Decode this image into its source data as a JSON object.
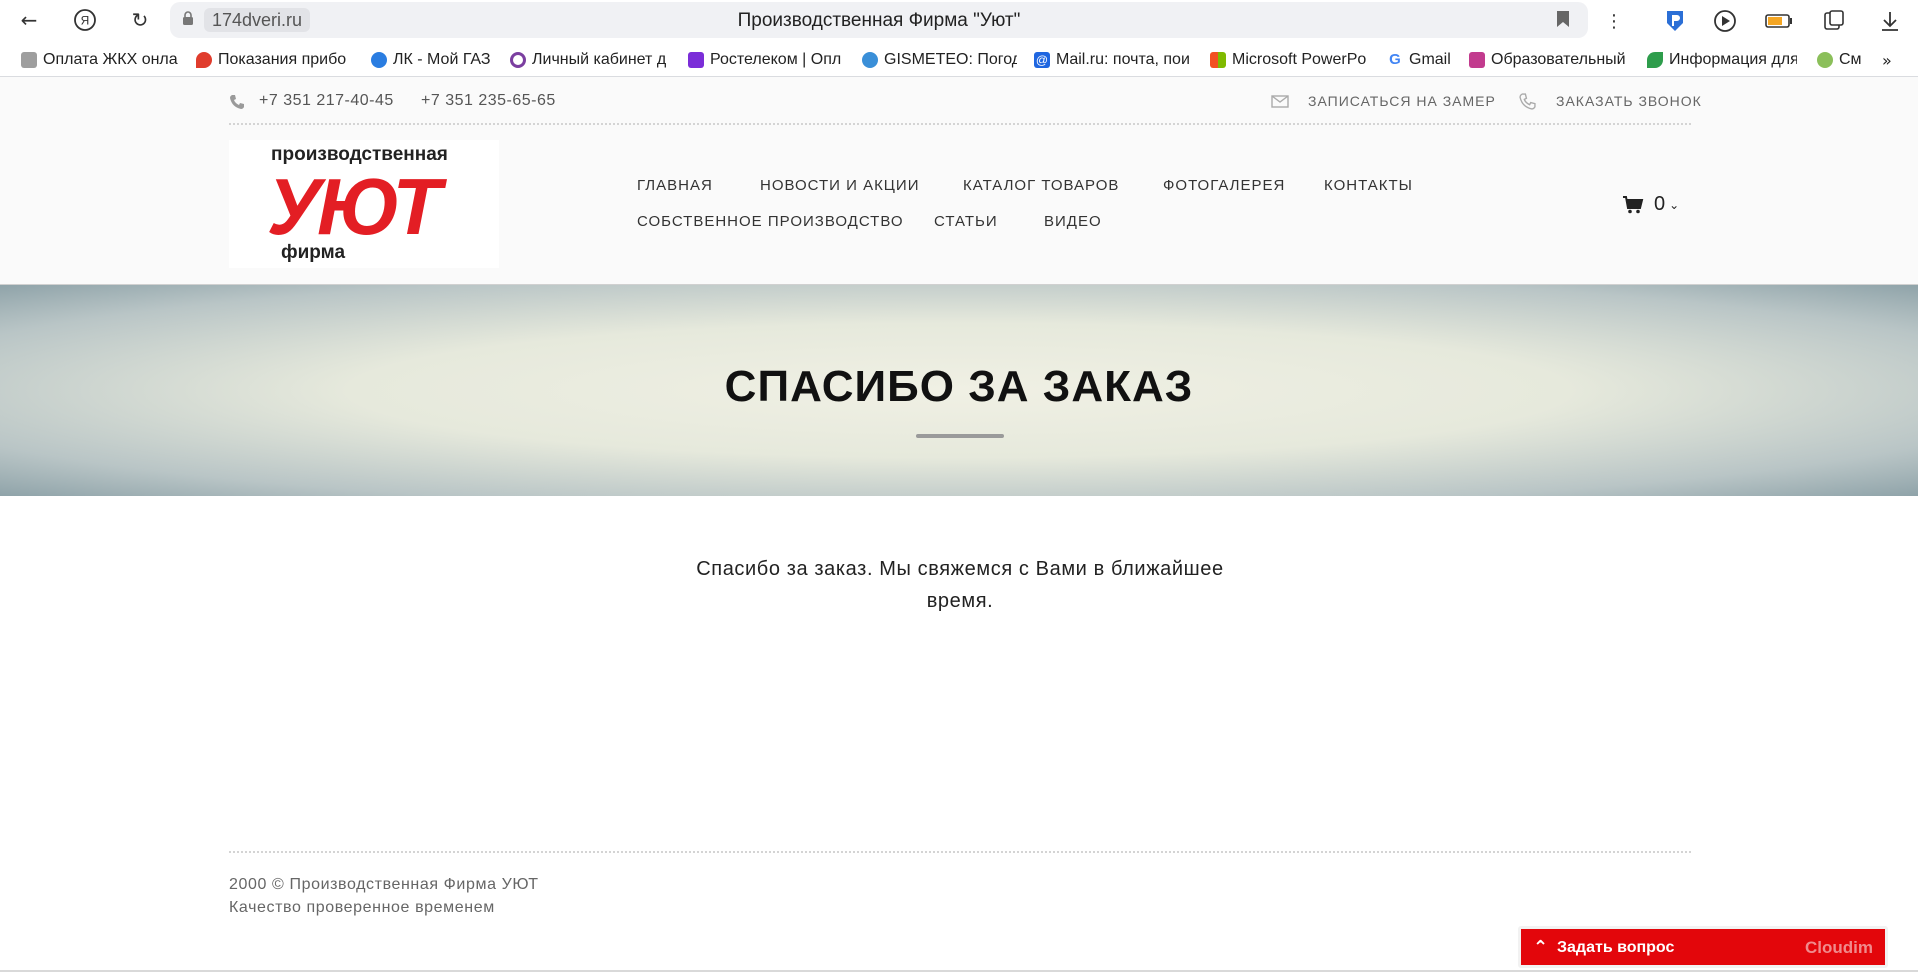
{
  "browser": {
    "url": "174dveri.ru",
    "tab_title": "Производственная Фирма \"Уют\"",
    "bookmarks": [
      {
        "label": "Оплата ЖКХ онла",
        "icon": "document-icon",
        "color": "#7a7a7a"
      },
      {
        "label": "Показания прибо",
        "icon": "drop-icon",
        "color": "#e03c2d"
      },
      {
        "label": "ЛК - Мой ГАЗ",
        "icon": "flame-icon",
        "color": "#2a7de1"
      },
      {
        "label": "Личный кабинет д",
        "icon": "ring-icon",
        "color": "#7b3fa0"
      },
      {
        "label": "Ростелеком | Опл",
        "icon": "rostelecom-icon",
        "color": "#7b2dd8"
      },
      {
        "label": "GISMETEO: Погод",
        "icon": "weather-icon",
        "color": "#3a8fd8"
      },
      {
        "label": "Mail.ru: почта, пои",
        "icon": "at-icon",
        "color": "#1f66e0"
      },
      {
        "label": "Microsoft PowerPo",
        "icon": "windows-icon",
        "color": "#f25022"
      },
      {
        "label": "Gmail",
        "icon": "google-icon",
        "color": "#4285f4"
      },
      {
        "label": "Образовательный",
        "icon": "school-icon",
        "color": "#c23b8e"
      },
      {
        "label": "Информация для",
        "icon": "leaf-icon",
        "color": "#2e9d4c"
      },
      {
        "label": "См",
        "icon": "tree-icon",
        "color": "#8bbf5a"
      }
    ]
  },
  "header": {
    "phones": [
      "+7 351 217-40-45",
      "+7 351 235-65-65"
    ],
    "measure_link": "ЗАПИСАТЬСЯ НА ЗАМЕР",
    "callback_link": "ЗАКАЗАТЬ ЗВОНОК",
    "logo": {
      "top": "производственная",
      "main": "УЮТ",
      "bottom": "фирма",
      "color": "#e31e24"
    },
    "nav": [
      "ГЛАВНАЯ",
      "НОВОСТИ И АКЦИИ",
      "КАТАЛОГ ТОВАРОВ",
      "ФОТОГАЛЕРЕЯ",
      "КОНТАКТЫ",
      "СОБСТВЕННОЕ ПРОИЗВОДСТВО",
      "СТАТЬИ",
      "ВИДЕО"
    ],
    "cart_count": "0"
  },
  "hero": {
    "title": "СПАСИБО ЗА ЗАКАЗ"
  },
  "main": {
    "message": "Спасибо за заказ. Мы свяжемся с Вами в ближайшее время."
  },
  "footer": {
    "copyright": "2000 © Производственная Фирма УЮТ",
    "slogan": "Качество проверенное временем"
  },
  "widget": {
    "label": "Задать вопрос",
    "brand": "Cloudim",
    "color": "#e3060b"
  }
}
